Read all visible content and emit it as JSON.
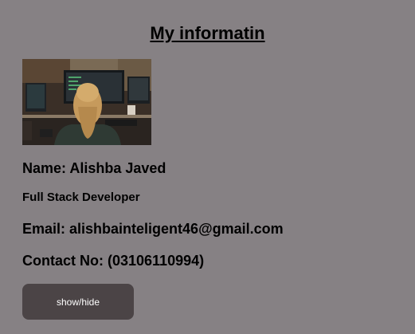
{
  "page": {
    "title": "My informatin",
    "background": "#868184"
  },
  "profile": {
    "photo_icon": "developer-at-desk-photo",
    "name": "Name: Alishba Javed",
    "role": "Full Stack Developer",
    "email": "Email: alishbainteligent46@gmail.com",
    "contact": "Contact No: (03106110994)"
  },
  "toggle_button": {
    "label": "show/hide",
    "color": "#4b4446"
  }
}
